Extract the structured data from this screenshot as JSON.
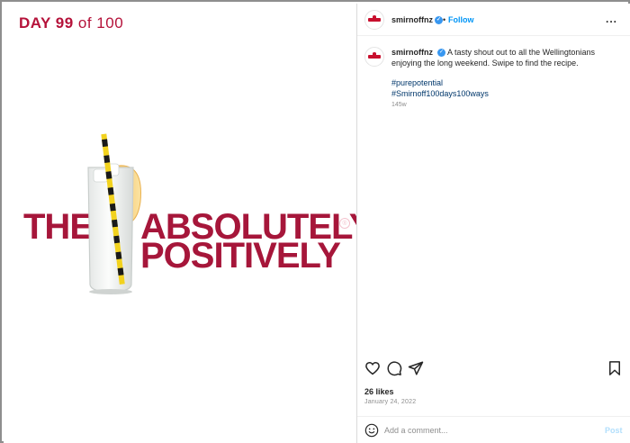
{
  "post_image": {
    "day_lead": "DAY 99",
    "day_rest": " of 100",
    "headline_the": "THE",
    "headline_absolutely": "ABSOLUTELY",
    "headline_positively": "POSITIVELY",
    "registered_mark": "®"
  },
  "header": {
    "username": "smirnoffnz",
    "verified_icon": "✓",
    "separator": "•",
    "follow_label": "Follow",
    "more_label": "..."
  },
  "caption": {
    "username": "smirnoffnz",
    "text": "A tasty shout out to all the Wellingtonians enjoying the long weekend. Swipe to find the recipe.",
    "hashtags": [
      "#purepotential",
      "#Smirnoff100days100ways"
    ],
    "age": "145w"
  },
  "actions": {
    "icons": [
      "heart-icon",
      "comment-icon",
      "share-icon",
      "bookmark-icon"
    ]
  },
  "likes_text": "26 likes",
  "date_text": "January 24, 2022",
  "comment_box": {
    "placeholder": "Add a comment...",
    "post_label": "Post"
  },
  "colors": {
    "brand_red": "#a6163a",
    "link_blue": "#0095f6",
    "hashtag_blue": "#00376b",
    "straw_yellow": "#f2d21e"
  }
}
